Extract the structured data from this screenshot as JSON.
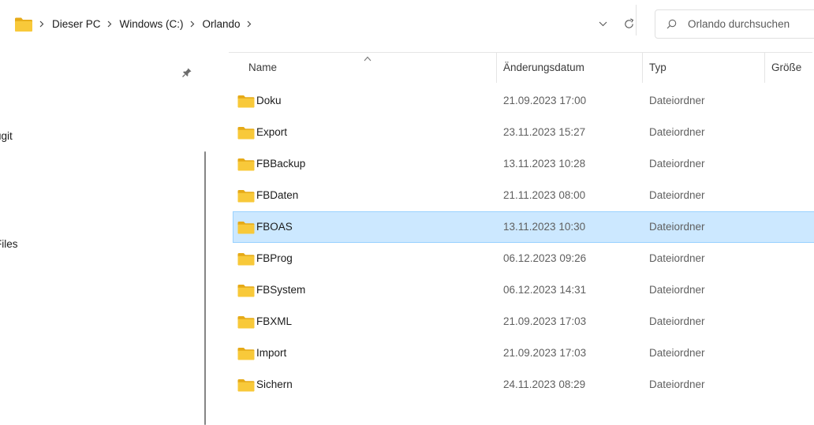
{
  "address_bar": {
    "breadcrumbs": [
      "Dieser PC",
      "Windows (C:)",
      "Orlando"
    ],
    "icons": {
      "folder": "folder-icon",
      "separator": "chevron-right-icon",
      "dropdown": "chevron-down-icon",
      "refresh": "refresh-icon"
    }
  },
  "search": {
    "placeholder": "Orlando durchsuchen",
    "icon": "search-icon"
  },
  "nav_pane": {
    "items": [
      "ugit",
      "Files"
    ],
    "pin_icon": "pin-icon"
  },
  "columns": {
    "name": "Name",
    "date": "Änderungsdatum",
    "type": "Typ",
    "size": "Größe"
  },
  "files": [
    {
      "name": "Doku",
      "date": "21.09.2023 17:00",
      "type": "Dateiordner",
      "selected": false
    },
    {
      "name": "Export",
      "date": "23.11.2023 15:27",
      "type": "Dateiordner",
      "selected": false
    },
    {
      "name": "FBBackup",
      "date": "13.11.2023 10:28",
      "type": "Dateiordner",
      "selected": false
    },
    {
      "name": "FBDaten",
      "date": "21.11.2023 08:00",
      "type": "Dateiordner",
      "selected": false
    },
    {
      "name": "FBOAS",
      "date": "13.11.2023 10:30",
      "type": "Dateiordner",
      "selected": true
    },
    {
      "name": "FBProg",
      "date": "06.12.2023 09:26",
      "type": "Dateiordner",
      "selected": false
    },
    {
      "name": "FBSystem",
      "date": "06.12.2023 14:31",
      "type": "Dateiordner",
      "selected": false
    },
    {
      "name": "FBXML",
      "date": "21.09.2023 17:03",
      "type": "Dateiordner",
      "selected": false
    },
    {
      "name": "Import",
      "date": "21.09.2023 17:03",
      "type": "Dateiordner",
      "selected": false
    },
    {
      "name": "Sichern",
      "date": "24.11.2023 08:29",
      "type": "Dateiordner",
      "selected": false
    }
  ],
  "colors": {
    "folder_body": "#f8c93a",
    "folder_tab": "#e6aa17",
    "selection_bg": "#cce8ff",
    "selection_border": "#99d1ff"
  }
}
